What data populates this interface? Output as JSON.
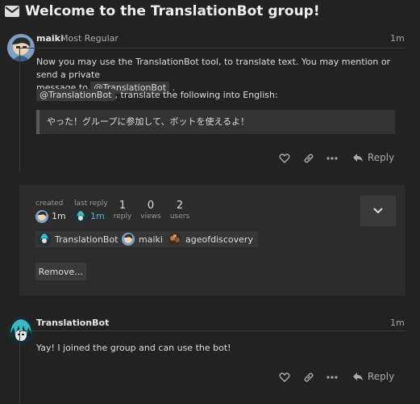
{
  "topic": {
    "title": "Welcome to the TranslationBot group!"
  },
  "post1": {
    "username": "maiki",
    "user_title": "Most Regular",
    "age": "1m",
    "line1": "Now you may use the TranslationBot tool, to translate text. You may mention or send a private",
    "line2_prefix": "message to",
    "mention": "@TranslationBot",
    "line2_suffix": ".",
    "para2_mention": "@TranslationBot",
    "para2_rest": ", translate the following into English:",
    "quote": "やった！グループに参加して、ボットを使えるよ！",
    "reply_label": "Reply"
  },
  "topic_map": {
    "created_label": "created",
    "created_time": "1m",
    "last_reply_label": "last reply",
    "last_reply_time": "1m",
    "replies_count": "1",
    "replies_label": "reply",
    "views_count": "0",
    "views_label": "views",
    "users_count": "2",
    "users_label": "users",
    "participants": [
      "TranslationBot",
      "maiki",
      "ageofdiscovery"
    ],
    "remove_label": "Remove…"
  },
  "post2": {
    "username": "TranslationBot",
    "age": "1m",
    "text": "Yay! I joined the group and can use the bot!",
    "reply_label": "Reply"
  },
  "colors": {
    "background": "#222222",
    "highlight": "#4fb3e6"
  },
  "icons": [
    "envelope-icon",
    "heart-icon",
    "link-icon",
    "ellipsis-icon",
    "reply-icon",
    "chevron-down-icon"
  ]
}
